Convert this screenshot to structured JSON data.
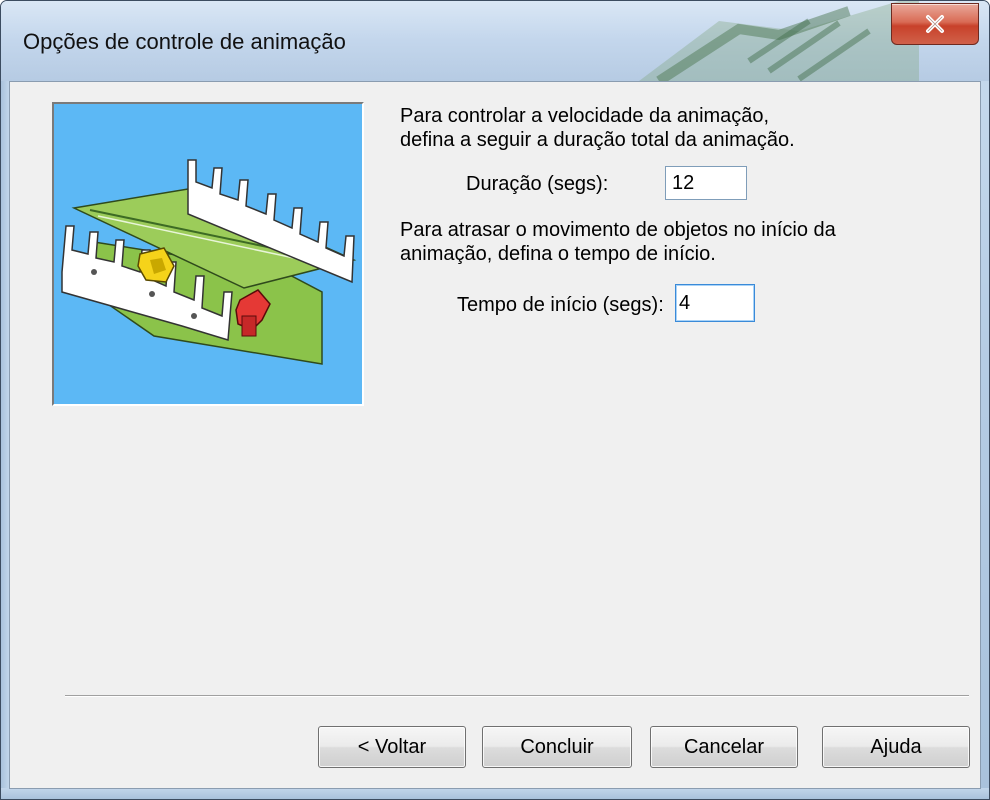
{
  "window": {
    "title": "Opções de controle de animação",
    "close_icon": "close-icon"
  },
  "content": {
    "illustration_icon": "animation-model-illustration",
    "speed_text": [
      "Para controlar a velocidade da animação,",
      "defina a seguir a duração total da animação."
    ],
    "duration_label": "Duração (segs):",
    "duration_value": "12",
    "delay_text": [
      "Para atrasar o movimento de objetos no início da",
      "animação, defina o tempo de início."
    ],
    "start_label": "Tempo de início (segs):",
    "start_value": "4"
  },
  "buttons": {
    "back": "< Voltar",
    "finish": "Concluir",
    "cancel": "Cancelar",
    "help": "Ajuda"
  },
  "colors": {
    "close_button": "#c8412a",
    "illustration_bg": "#5cb8f5",
    "dialog_bg": "#f0f0f0"
  }
}
